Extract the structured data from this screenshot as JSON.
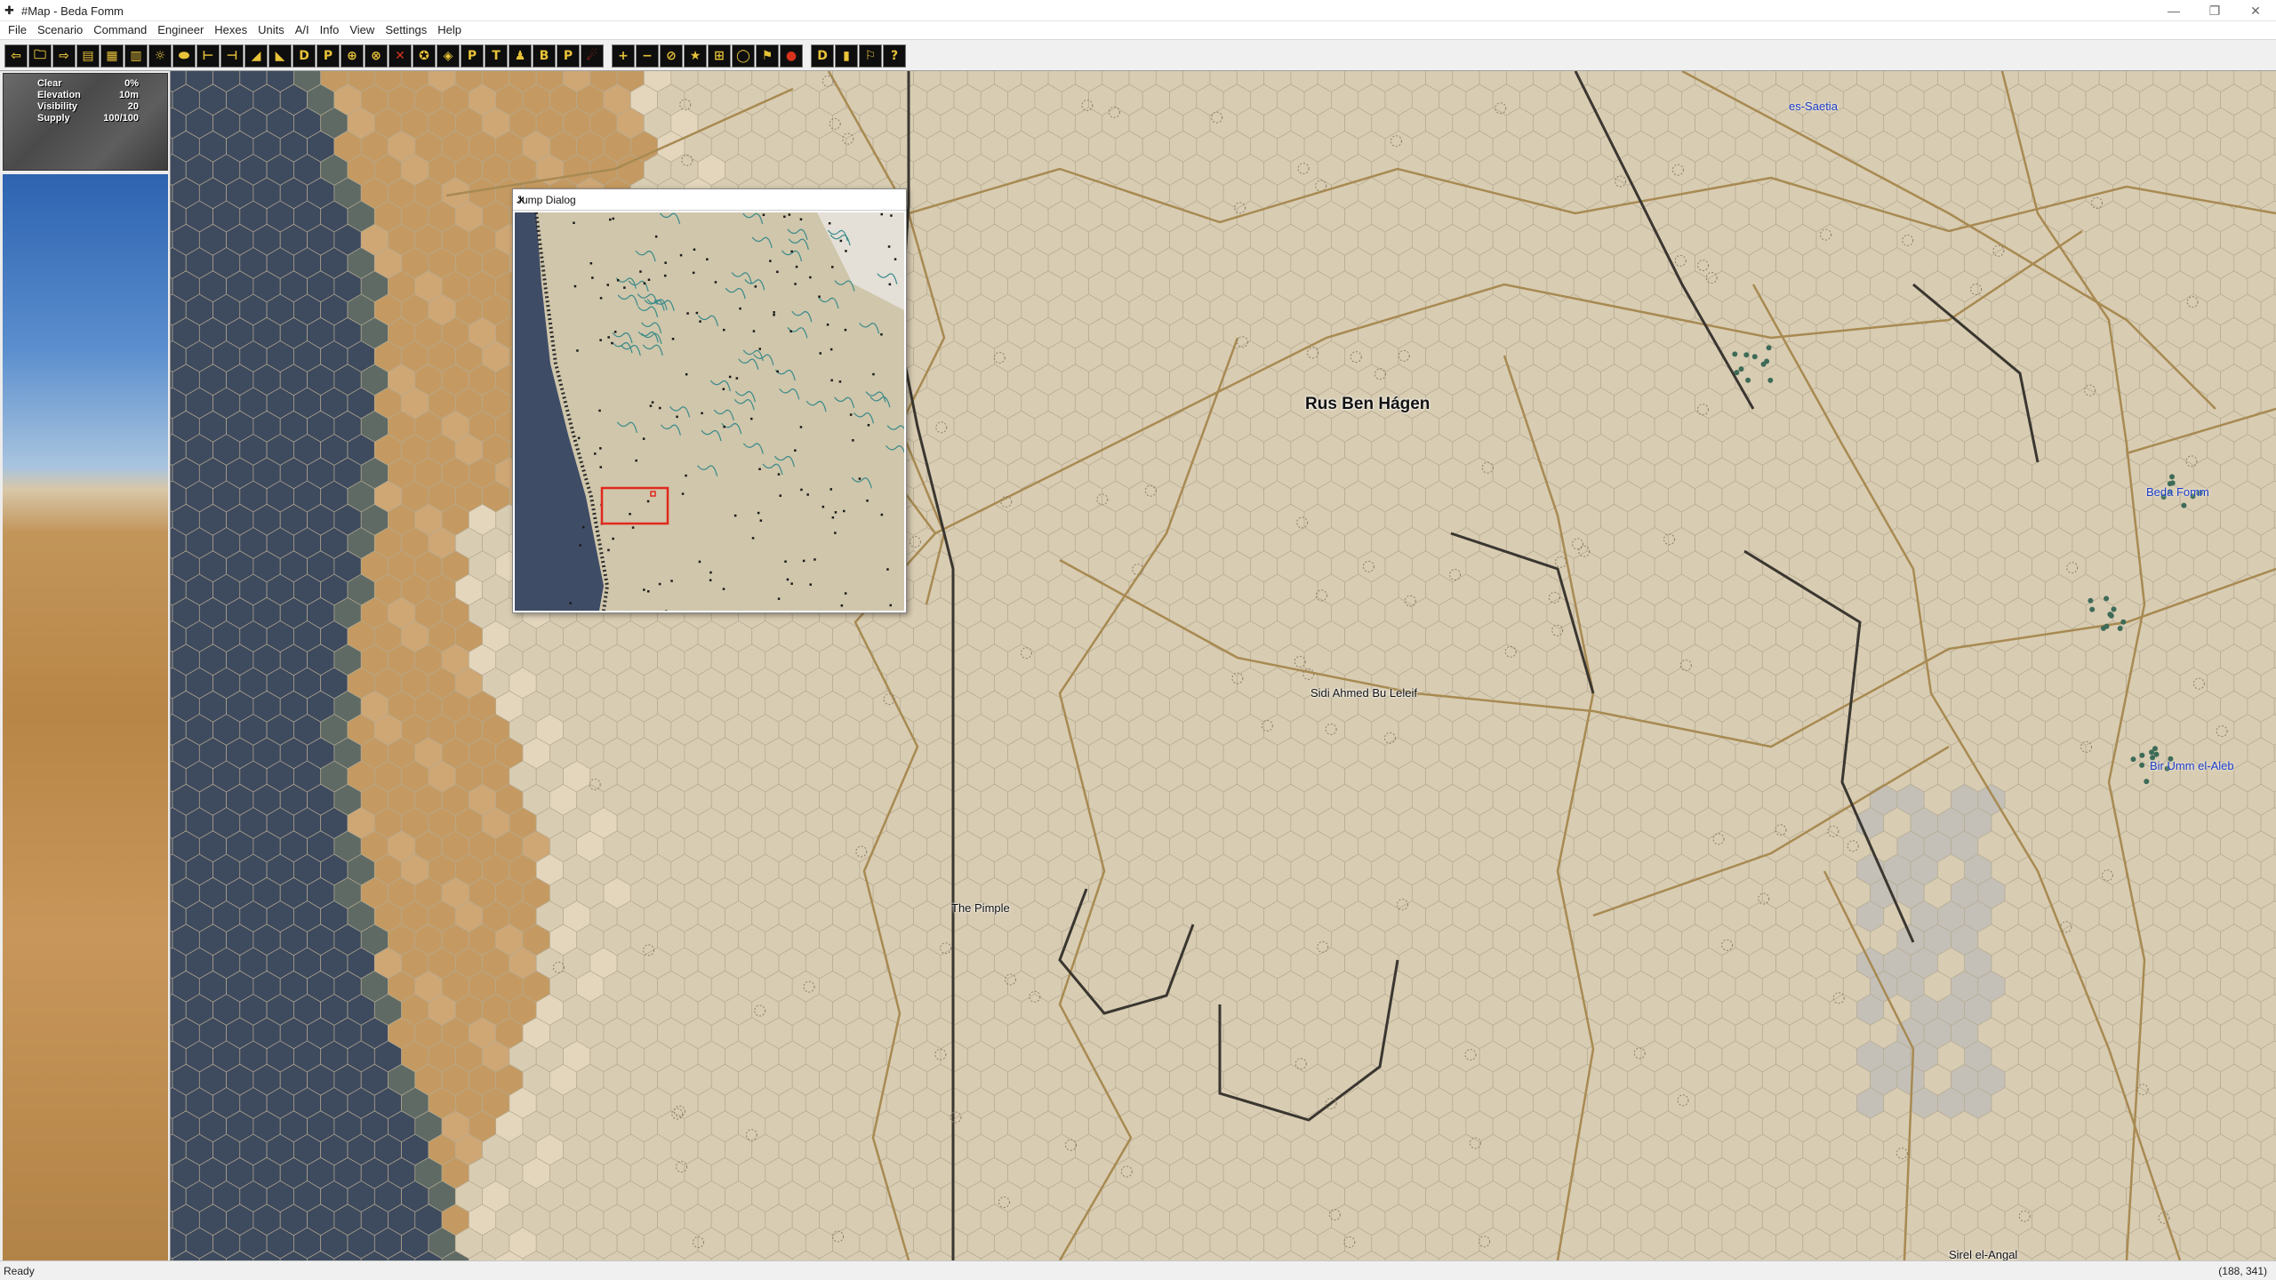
{
  "window": {
    "title": "#Map - Beda Fomm",
    "minimize": "—",
    "restore": "❐",
    "close": "✕"
  },
  "menu": [
    "File",
    "Scenario",
    "Command",
    "Engineer",
    "Hexes",
    "Units",
    "A/I",
    "Info",
    "View",
    "Settings",
    "Help"
  ],
  "toolbar": {
    "buttons": [
      "⇦",
      "🗀",
      "⇨",
      "▤",
      "▦",
      "▥",
      "☼",
      "⬬",
      "⊢",
      "⊣",
      "◢",
      "◣",
      "D",
      "P",
      "⊕",
      "⊗",
      "✕",
      "✪",
      "◈",
      "P",
      "T",
      "♟",
      "B",
      "P",
      "☄",
      "+",
      "−",
      "⊘",
      "★",
      "⊞",
      "◯",
      "⚑",
      "●",
      "D",
      "▮",
      "⚐",
      "?"
    ]
  },
  "info": {
    "rows": [
      {
        "label": "Clear",
        "value": "0%"
      },
      {
        "label": "Elevation",
        "value": "10m"
      },
      {
        "label": "Visibility",
        "value": "20"
      },
      {
        "label": "Supply",
        "value": "100/100"
      }
    ]
  },
  "map": {
    "places": [
      {
        "name": "Rus Ben Hágen",
        "type": "big"
      },
      {
        "name": "Sidi Ahmed Bu Leleif",
        "type": "small"
      },
      {
        "name": "The Pimple",
        "type": "small"
      },
      {
        "name": "Sirel el-Angal",
        "type": "small"
      },
      {
        "name": "es-Saetia",
        "type": "town"
      },
      {
        "name": "Beda Fomm",
        "type": "town"
      },
      {
        "name": "Bir Umm el-Aleb",
        "type": "town"
      }
    ]
  },
  "jump_dialog": {
    "title": "Jump Dialog",
    "close": "✕"
  },
  "status": {
    "text": "Ready",
    "coords": "(188, 341)"
  },
  "colors": {
    "sea": "#3e4a5e",
    "desert": "#d8ccb2",
    "sand": "#c49a62",
    "road": "#a88a52",
    "hexline": "#b5aa92",
    "escarp": "#3a3630"
  }
}
